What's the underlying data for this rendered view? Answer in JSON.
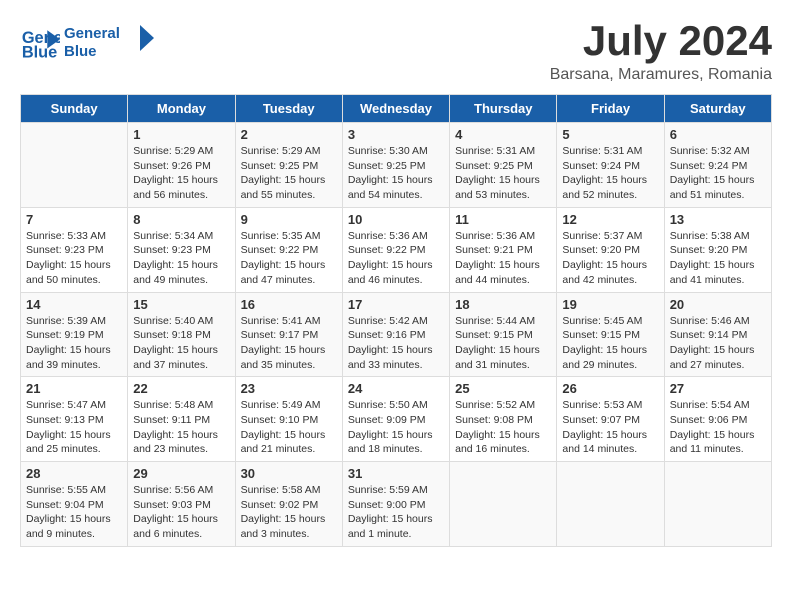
{
  "logo": {
    "text_line1": "General",
    "text_line2": "Blue"
  },
  "title": "July 2024",
  "location": "Barsana, Maramures, Romania",
  "days_of_week": [
    "Sunday",
    "Monday",
    "Tuesday",
    "Wednesday",
    "Thursday",
    "Friday",
    "Saturday"
  ],
  "weeks": [
    [
      {
        "day": "",
        "content": ""
      },
      {
        "day": "1",
        "content": "Sunrise: 5:29 AM\nSunset: 9:26 PM\nDaylight: 15 hours\nand 56 minutes."
      },
      {
        "day": "2",
        "content": "Sunrise: 5:29 AM\nSunset: 9:25 PM\nDaylight: 15 hours\nand 55 minutes."
      },
      {
        "day": "3",
        "content": "Sunrise: 5:30 AM\nSunset: 9:25 PM\nDaylight: 15 hours\nand 54 minutes."
      },
      {
        "day": "4",
        "content": "Sunrise: 5:31 AM\nSunset: 9:25 PM\nDaylight: 15 hours\nand 53 minutes."
      },
      {
        "day": "5",
        "content": "Sunrise: 5:31 AM\nSunset: 9:24 PM\nDaylight: 15 hours\nand 52 minutes."
      },
      {
        "day": "6",
        "content": "Sunrise: 5:32 AM\nSunset: 9:24 PM\nDaylight: 15 hours\nand 51 minutes."
      }
    ],
    [
      {
        "day": "7",
        "content": "Sunrise: 5:33 AM\nSunset: 9:23 PM\nDaylight: 15 hours\nand 50 minutes."
      },
      {
        "day": "8",
        "content": "Sunrise: 5:34 AM\nSunset: 9:23 PM\nDaylight: 15 hours\nand 49 minutes."
      },
      {
        "day": "9",
        "content": "Sunrise: 5:35 AM\nSunset: 9:22 PM\nDaylight: 15 hours\nand 47 minutes."
      },
      {
        "day": "10",
        "content": "Sunrise: 5:36 AM\nSunset: 9:22 PM\nDaylight: 15 hours\nand 46 minutes."
      },
      {
        "day": "11",
        "content": "Sunrise: 5:36 AM\nSunset: 9:21 PM\nDaylight: 15 hours\nand 44 minutes."
      },
      {
        "day": "12",
        "content": "Sunrise: 5:37 AM\nSunset: 9:20 PM\nDaylight: 15 hours\nand 42 minutes."
      },
      {
        "day": "13",
        "content": "Sunrise: 5:38 AM\nSunset: 9:20 PM\nDaylight: 15 hours\nand 41 minutes."
      }
    ],
    [
      {
        "day": "14",
        "content": "Sunrise: 5:39 AM\nSunset: 9:19 PM\nDaylight: 15 hours\nand 39 minutes."
      },
      {
        "day": "15",
        "content": "Sunrise: 5:40 AM\nSunset: 9:18 PM\nDaylight: 15 hours\nand 37 minutes."
      },
      {
        "day": "16",
        "content": "Sunrise: 5:41 AM\nSunset: 9:17 PM\nDaylight: 15 hours\nand 35 minutes."
      },
      {
        "day": "17",
        "content": "Sunrise: 5:42 AM\nSunset: 9:16 PM\nDaylight: 15 hours\nand 33 minutes."
      },
      {
        "day": "18",
        "content": "Sunrise: 5:44 AM\nSunset: 9:15 PM\nDaylight: 15 hours\nand 31 minutes."
      },
      {
        "day": "19",
        "content": "Sunrise: 5:45 AM\nSunset: 9:15 PM\nDaylight: 15 hours\nand 29 minutes."
      },
      {
        "day": "20",
        "content": "Sunrise: 5:46 AM\nSunset: 9:14 PM\nDaylight: 15 hours\nand 27 minutes."
      }
    ],
    [
      {
        "day": "21",
        "content": "Sunrise: 5:47 AM\nSunset: 9:13 PM\nDaylight: 15 hours\nand 25 minutes."
      },
      {
        "day": "22",
        "content": "Sunrise: 5:48 AM\nSunset: 9:11 PM\nDaylight: 15 hours\nand 23 minutes."
      },
      {
        "day": "23",
        "content": "Sunrise: 5:49 AM\nSunset: 9:10 PM\nDaylight: 15 hours\nand 21 minutes."
      },
      {
        "day": "24",
        "content": "Sunrise: 5:50 AM\nSunset: 9:09 PM\nDaylight: 15 hours\nand 18 minutes."
      },
      {
        "day": "25",
        "content": "Sunrise: 5:52 AM\nSunset: 9:08 PM\nDaylight: 15 hours\nand 16 minutes."
      },
      {
        "day": "26",
        "content": "Sunrise: 5:53 AM\nSunset: 9:07 PM\nDaylight: 15 hours\nand 14 minutes."
      },
      {
        "day": "27",
        "content": "Sunrise: 5:54 AM\nSunset: 9:06 PM\nDaylight: 15 hours\nand 11 minutes."
      }
    ],
    [
      {
        "day": "28",
        "content": "Sunrise: 5:55 AM\nSunset: 9:04 PM\nDaylight: 15 hours\nand 9 minutes."
      },
      {
        "day": "29",
        "content": "Sunrise: 5:56 AM\nSunset: 9:03 PM\nDaylight: 15 hours\nand 6 minutes."
      },
      {
        "day": "30",
        "content": "Sunrise: 5:58 AM\nSunset: 9:02 PM\nDaylight: 15 hours\nand 3 minutes."
      },
      {
        "day": "31",
        "content": "Sunrise: 5:59 AM\nSunset: 9:00 PM\nDaylight: 15 hours\nand 1 minute."
      },
      {
        "day": "",
        "content": ""
      },
      {
        "day": "",
        "content": ""
      },
      {
        "day": "",
        "content": ""
      }
    ]
  ]
}
